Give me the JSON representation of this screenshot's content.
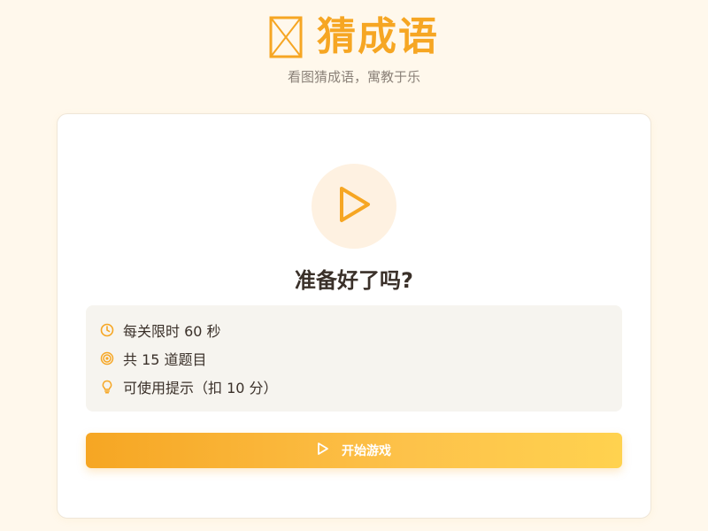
{
  "header": {
    "logo_icon": "broken-image-icon",
    "title": "猜成语",
    "subtitle": "看图猜成语，寓教于乐"
  },
  "start_card": {
    "play_icon": "play-icon",
    "heading": "准备好了吗?",
    "rules": [
      {
        "icon": "clock-icon",
        "text": "每关限时 60 秒"
      },
      {
        "icon": "target-icon",
        "text": "共 15 道题目"
      },
      {
        "icon": "lightbulb-icon",
        "text": "可使用提示（扣 10 分）"
      }
    ],
    "start_button": {
      "icon": "play-icon",
      "label": "开始游戏"
    }
  },
  "colors": {
    "accent": "#f6a623",
    "accent_light": "#ffd24f",
    "background": "#fff8ec",
    "play_circle_bg": "#fef1e1",
    "rules_bg": "#f6f4ef"
  }
}
